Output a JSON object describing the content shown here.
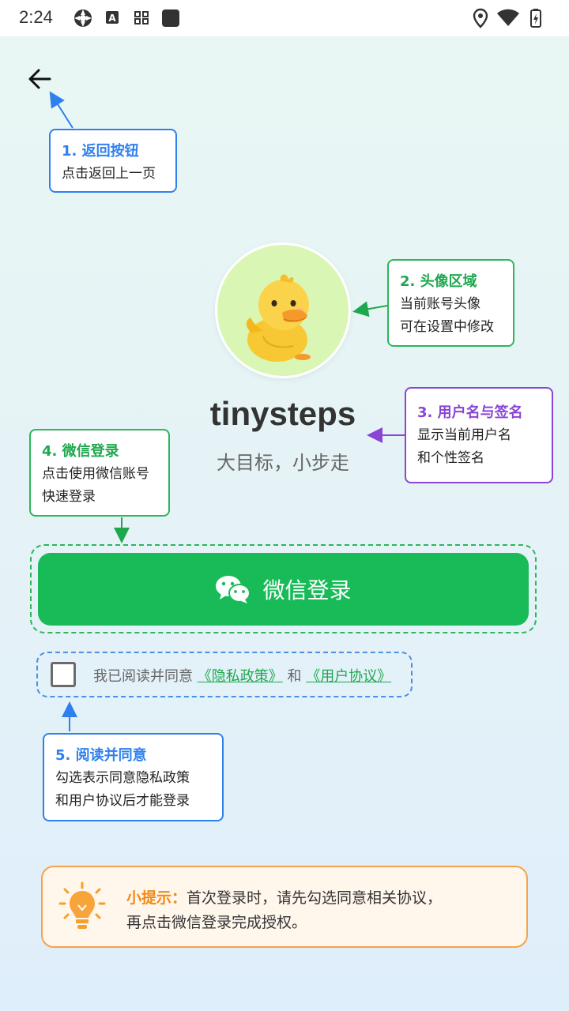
{
  "status_bar": {
    "time": "2:24",
    "icons": [
      "settings-icon",
      "text-a-icon",
      "qr-grid-icon",
      "app-square-icon",
      "location-icon",
      "wifi-icon",
      "battery-icon"
    ]
  },
  "back_button": {
    "icon": "arrow-left-icon"
  },
  "callouts": {
    "back": {
      "title": "1. 返回按钮",
      "desc": "点击返回上一页"
    },
    "avatar": {
      "title": "2. 头像区域",
      "line1": "当前账号头像",
      "line2": "可在设置中修改"
    },
    "username": {
      "title": "3. 用户名与签名",
      "line1": "显示当前用户名",
      "line2": "和个性签名"
    },
    "wechat": {
      "title": "4. 微信登录",
      "line1": "点击使用微信账号",
      "line2": "快速登录"
    },
    "agree": {
      "title": "5. 阅读并同意",
      "line1": "勾选表示同意隐私政策",
      "line2": "和用户协议后才能登录"
    }
  },
  "profile": {
    "username": "tinysteps",
    "signature": "大目标，小步走",
    "avatar": "duckling-avatar"
  },
  "wechat_login": {
    "label": "微信登录",
    "icon": "wechat-icon"
  },
  "agreement": {
    "checked": false,
    "prefix": "我已阅读并同意",
    "privacy_link": "《隐私政策》",
    "and": "和",
    "terms_link": "《用户协议》"
  },
  "tip": {
    "title": "小提示：",
    "line1": "首次登录时，请先勾选同意相关协议，",
    "line2": "再点击微信登录完成授权。",
    "icon": "lightbulb-icon"
  },
  "colors": {
    "wechat_green": "#18bb58",
    "callout_blue": "#2f80ed",
    "callout_purple": "#8a44d6",
    "tip_orange": "#f08a18"
  }
}
